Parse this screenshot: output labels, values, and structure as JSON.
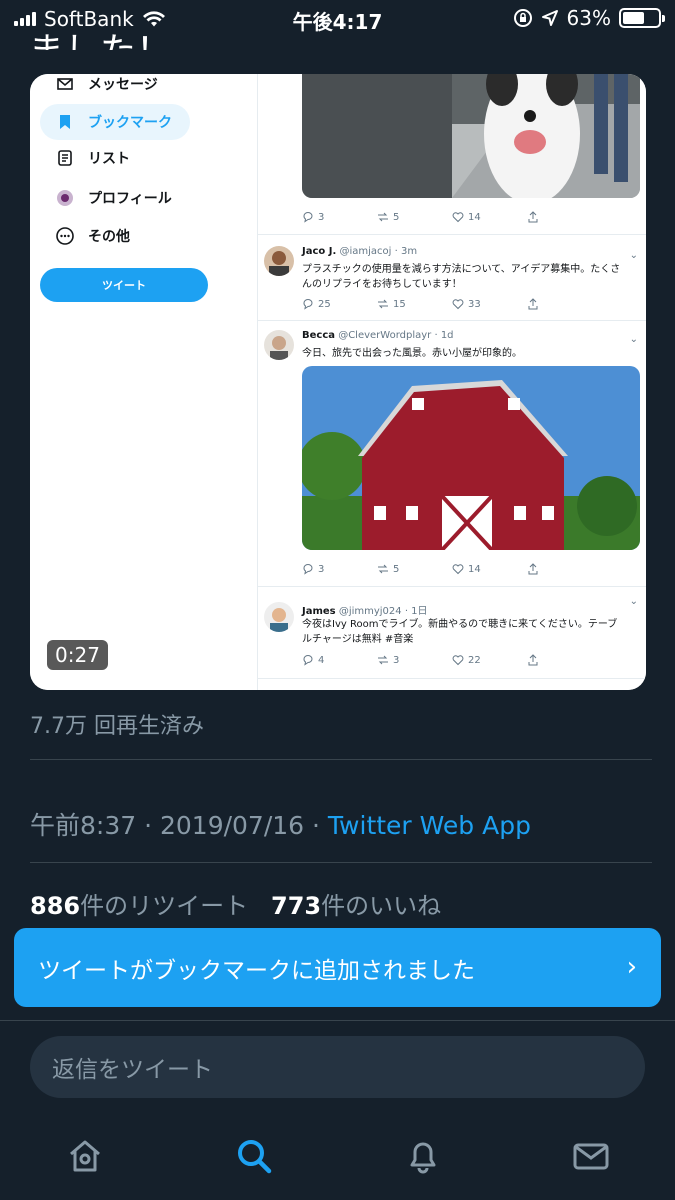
{
  "status_bar": {
    "carrier": "SoftBank",
    "time": "午後4:17",
    "battery": "63%",
    "battery_level": 0.63
  },
  "tweet": {
    "text_fragment": "ました！",
    "video": {
      "duration": "0:27",
      "sidebar": [
        {
          "label": "メッセージ",
          "icon": "envelope-icon"
        },
        {
          "label": "ブックマーク",
          "icon": "bookmark-icon",
          "active": true
        },
        {
          "label": "リスト",
          "icon": "list-icon"
        },
        {
          "label": "プロフィール",
          "icon": "profile-icon"
        },
        {
          "label": "その他",
          "icon": "more-icon"
        }
      ],
      "tweet_button": "ツイート",
      "feed": [
        {
          "replies": "3",
          "retweets": "5",
          "likes": "14"
        },
        {
          "name": "Jaco J.",
          "handle": "@iamjacoj · 3m",
          "text": "プラスチックの使用量を減らす方法について、アイデア募集中。たくさんのリプライをお待ちしています！",
          "replies": "25",
          "retweets": "15",
          "likes": "33"
        },
        {
          "name": "Becca",
          "handle": "@CleverWordplayr · 1d",
          "text": "今日、旅先で出会った風景。赤い小屋が印象的。",
          "replies": "3",
          "retweets": "5",
          "likes": "14"
        },
        {
          "name": "James",
          "handle": "@jimmyj024 · 1日",
          "text": "今夜はIvy Roomでライブ。新曲やるので聴きに来てください。テーブルチャージは無料 #音楽",
          "replies": "4",
          "retweets": "3",
          "likes": "22"
        }
      ]
    },
    "views": "7.7万 回再生済み",
    "time": "午前8:37",
    "date": "2019/07/16",
    "source": "Twitter Web App",
    "retweets_count": "886",
    "retweets_label": "件のリツイート",
    "likes_count": "773",
    "likes_label": "件のいいね"
  },
  "toast": {
    "message": "ツイートがブックマークに追加されました",
    "arrow": "›"
  },
  "reply": {
    "placeholder": "返信をツイート"
  },
  "tabbar": [
    "home-icon",
    "search-icon",
    "notifications-icon",
    "messages-icon"
  ],
  "colors": {
    "background": "#15202b",
    "accent": "#1da1f2",
    "muted": "#8899a6"
  }
}
